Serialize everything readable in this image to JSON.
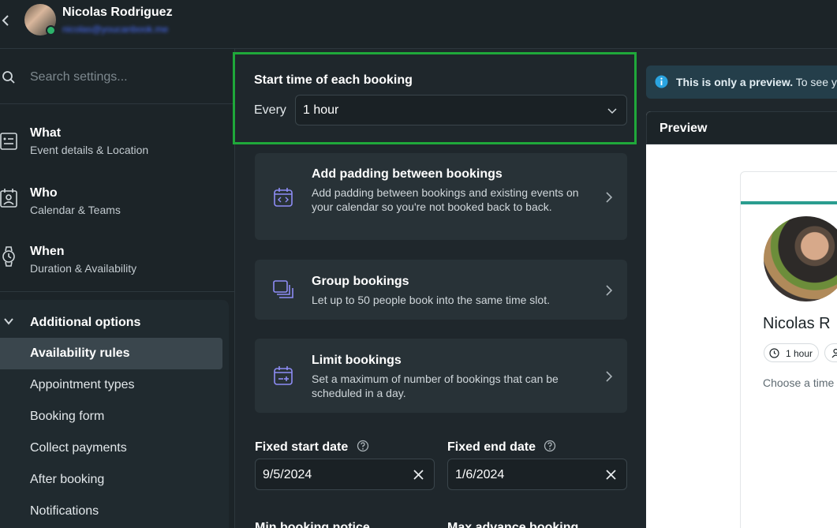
{
  "header": {
    "back_icon": "chevron-left-icon",
    "user_name": "Nicolas Rodriguez",
    "user_email": "nicolas@youcanbook.me"
  },
  "sidebar": {
    "search_placeholder": "Search settings...",
    "nav": [
      {
        "title": "What",
        "subtitle": "Event details & Location",
        "icon": "id-card-icon"
      },
      {
        "title": "Who",
        "subtitle": "Calendar & Teams",
        "icon": "contact-card-icon"
      },
      {
        "title": "When",
        "subtitle": "Duration & Availability",
        "icon": "watch-icon"
      }
    ],
    "additional": {
      "title": "Additional options",
      "items": [
        {
          "label": "Availability rules",
          "active": true
        },
        {
          "label": "Appointment types"
        },
        {
          "label": "Booking form"
        },
        {
          "label": "Collect payments"
        },
        {
          "label": "After booking"
        },
        {
          "label": "Notifications"
        }
      ]
    }
  },
  "main": {
    "start_time": {
      "title": "Start time of each booking",
      "every_label": "Every",
      "selected": "1 hour"
    },
    "cards": [
      {
        "title": "Add padding between bookings",
        "desc": "Add padding between bookings and existing events on your calendar so you're not booked back to back.",
        "icon": "calendar-code-icon"
      },
      {
        "title": "Group bookings",
        "desc": "Let up to 50 people book into the same time slot.",
        "icon": "stacked-cards-icon"
      },
      {
        "title": "Limit bookings",
        "desc": "Set a maximum of number of bookings that can be scheduled in a day.",
        "icon": "calendar-plus-icon"
      }
    ],
    "fixed_start": {
      "label": "Fixed start date",
      "value": "9/5/2024"
    },
    "fixed_end": {
      "label": "Fixed end date",
      "value": "1/6/2024"
    },
    "partial_labels": [
      "Min booking notice",
      "Max advance booking"
    ]
  },
  "preview": {
    "notice_strong": "This is only a preview.",
    "notice_rest": " To see y",
    "title": "Preview",
    "card": {
      "name": "Nicolas R",
      "duration_chip": "1 hour",
      "choose_text": "Choose a time"
    }
  },
  "colors": {
    "accent_green": "#1fa83a",
    "icon_purple": "#8e8cf5",
    "teal_bar": "#2a9d8f",
    "info_blue": "#2aa4e0"
  }
}
